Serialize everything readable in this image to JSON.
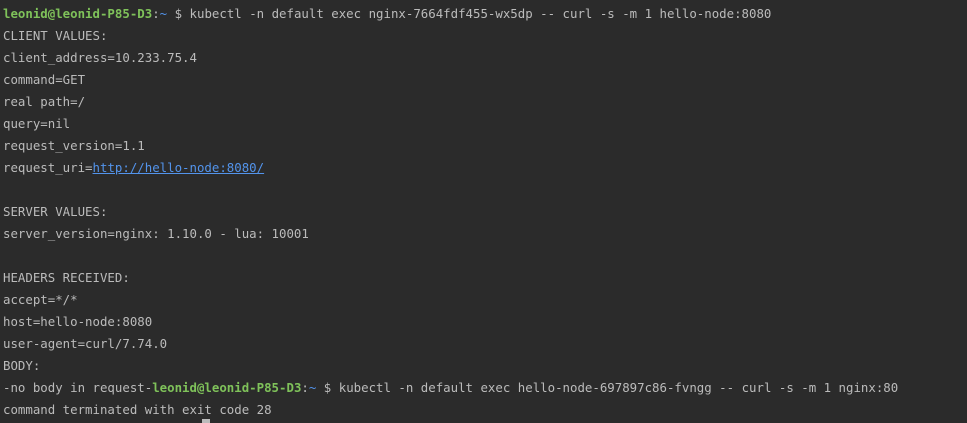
{
  "prompt": {
    "user_host": "leonid@leonid-P85-D3",
    "colon": ":",
    "cwd": "~",
    "symbol": " $ "
  },
  "lines": {
    "cmd1": "kubectl -n default exec nginx-7664fdf455-wx5dp -- curl -s -m 1 hello-node:8080",
    "client_header": "CLIENT VALUES:",
    "client_address": "client_address=10.233.75.4",
    "command": "command=GET",
    "real_path": "real path=/",
    "query": "query=nil",
    "request_version": "request_version=1.1",
    "request_uri_prefix": "request_uri=",
    "request_uri_link": "http://hello-node:8080/",
    "server_header": "SERVER VALUES:",
    "server_version": "server_version=nginx: 1.10.0 - lua: 10001",
    "headers_header": "HEADERS RECEIVED:",
    "accept": "accept=*/*",
    "host": "host=hello-node:8080",
    "user_agent": "user-agent=curl/7.74.0",
    "body": "BODY:",
    "no_body_prefix": "-no body in request-",
    "cmd2": "kubectl -n default exec hello-node-697897c86-fvngg -- curl -s -m 1 nginx:80",
    "exit_msg": "command terminated with exit code 28"
  },
  "colors": {
    "background": "#2b2b2b",
    "text": "#bbbbbb",
    "prompt_user": "#7fc25a",
    "prompt_path": "#5394ec",
    "link": "#5394ec"
  }
}
